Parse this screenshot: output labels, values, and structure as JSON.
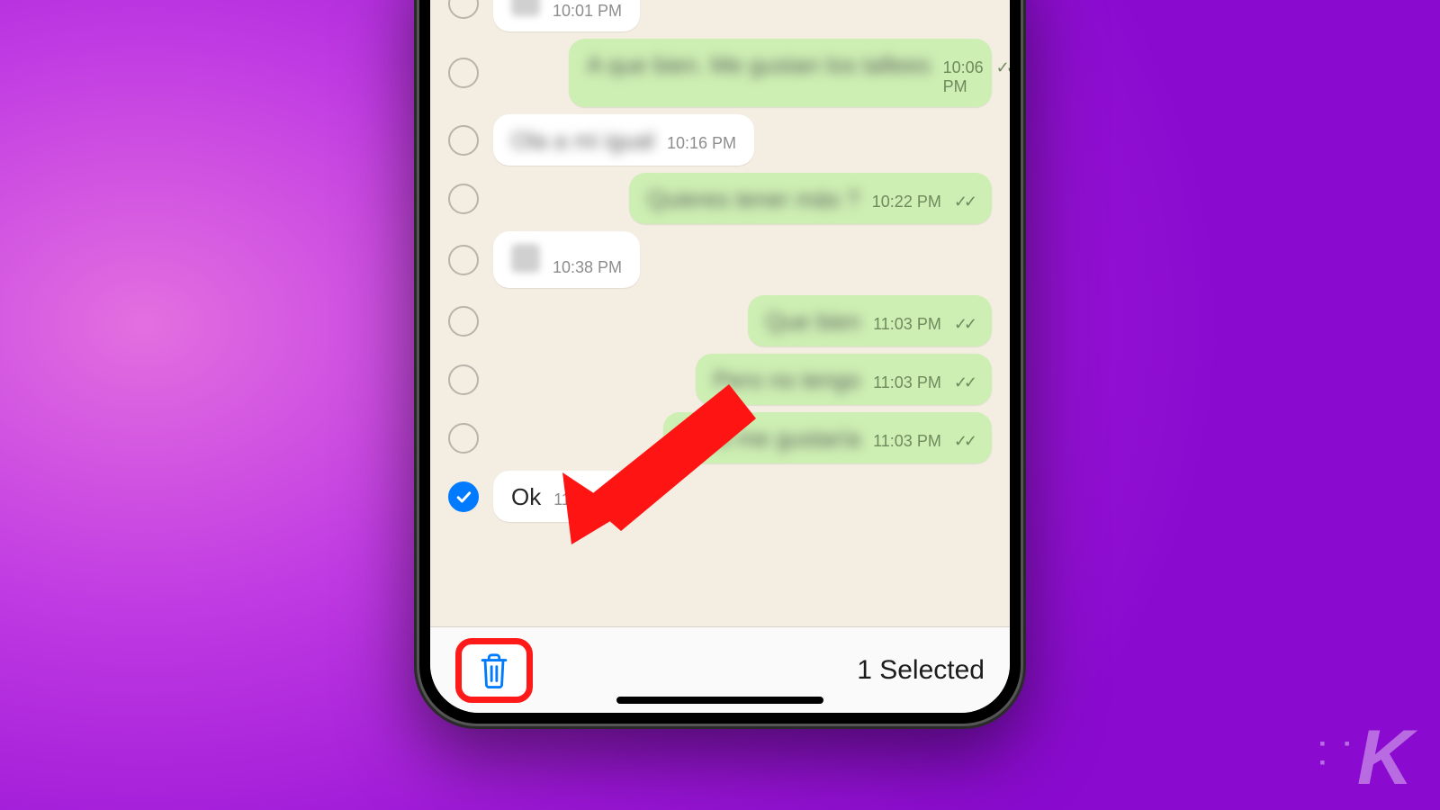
{
  "messages": [
    {
      "side": "in",
      "selected": false,
      "text": "",
      "blurred": true,
      "thumb": true,
      "time": "10:01 PM",
      "ticks": false
    },
    {
      "side": "out",
      "selected": false,
      "text": "A que bien. Me gustan los tallees",
      "blurred": true,
      "thumb": false,
      "time": "10:06 PM",
      "ticks": true
    },
    {
      "side": "in",
      "selected": false,
      "text": "Ola a mi igual",
      "blurred": true,
      "thumb": false,
      "time": "10:16 PM",
      "ticks": false
    },
    {
      "side": "out",
      "selected": false,
      "text": "Quieres tener más ?",
      "blurred": true,
      "thumb": false,
      "time": "10:22 PM",
      "ticks": true
    },
    {
      "side": "in",
      "selected": false,
      "text": "",
      "blurred": true,
      "thumb": true,
      "time": "10:38 PM",
      "ticks": false
    },
    {
      "side": "out",
      "selected": false,
      "text": "Que bien",
      "blurred": true,
      "thumb": false,
      "time": "11:03 PM",
      "ticks": true
    },
    {
      "side": "out",
      "selected": false,
      "text": "Pero no tengo",
      "blurred": true,
      "thumb": false,
      "time": "11:03 PM",
      "ticks": true
    },
    {
      "side": "out",
      "selected": false,
      "text": "Pero me gustaría",
      "blurred": true,
      "thumb": false,
      "time": "11:03 PM",
      "ticks": true
    },
    {
      "side": "in",
      "selected": true,
      "text": "Ok",
      "blurred": false,
      "thumb": false,
      "time": "11:04 PM",
      "ticks": false
    }
  ],
  "toolbar": {
    "selected_label": "1 Selected"
  },
  "brand": {
    "letter": "K"
  }
}
